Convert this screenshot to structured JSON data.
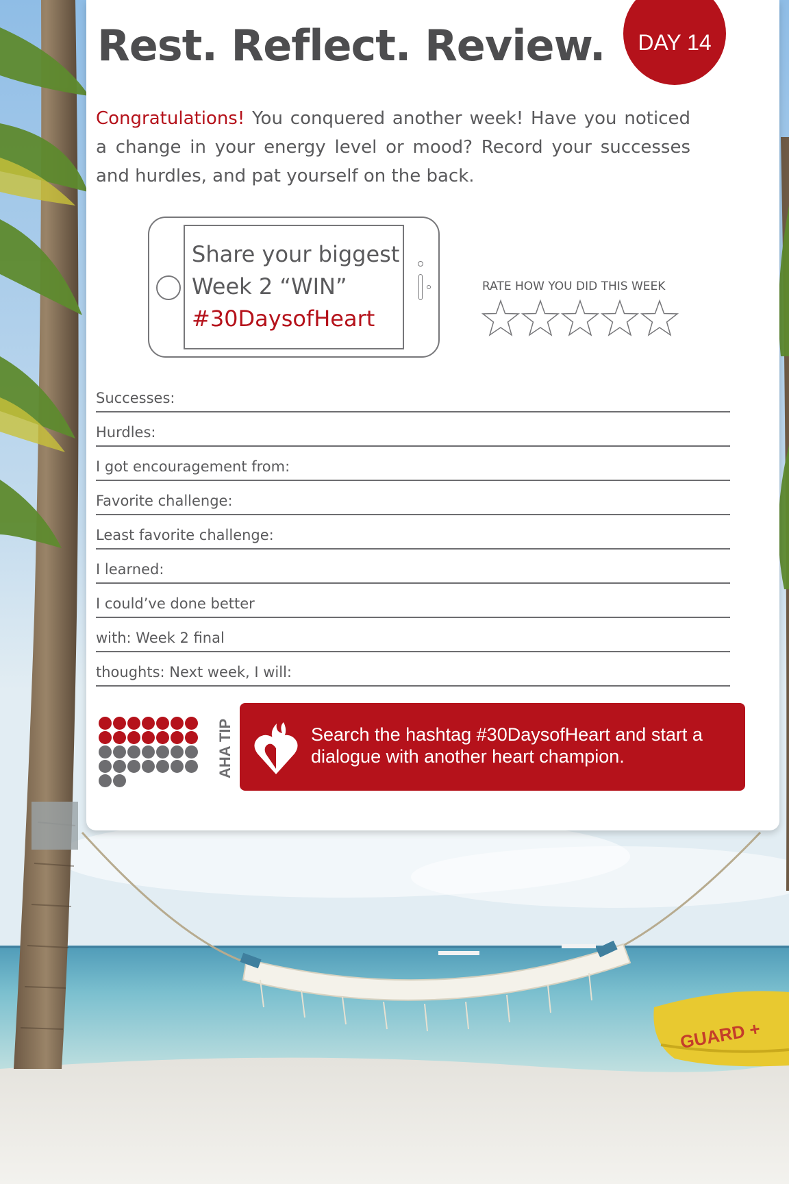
{
  "header": {
    "title": "Rest. Reflect. Review.",
    "day_badge": "DAY 14"
  },
  "intro": {
    "highlight": "Congratulations!",
    "text": " You conquered another week! Have you noticed a change in your energy level or mood? Record your successes and hurdles, and pat yourself on the back."
  },
  "phone": {
    "line1": "Share your biggest",
    "line2": "Week 2 “WIN”",
    "hashtag": "#30DaysofHeart"
  },
  "rating": {
    "label": "RATE HOW YOU DID THIS WEEK",
    "max_stars": 5,
    "selected": 0
  },
  "fields": [
    "Successes:",
    "Hurdles:",
    "I got encouragement from:",
    "Favorite challenge:",
    "Least favorite challenge:",
    "I learned:",
    "I could’ve done better",
    "with: Week 2 final",
    "thoughts: Next week, I will:"
  ],
  "tip": {
    "label": "AHA TIP",
    "text": "Search the hashtag #30DaysofHeart and start a dialogue with another heart champion.",
    "progress_days_done": 14,
    "progress_days_total": 30
  },
  "colors": {
    "brand_red": "#b5121b",
    "text_gray": "#5a5a5c",
    "dot_gray": "#6d6d70"
  }
}
